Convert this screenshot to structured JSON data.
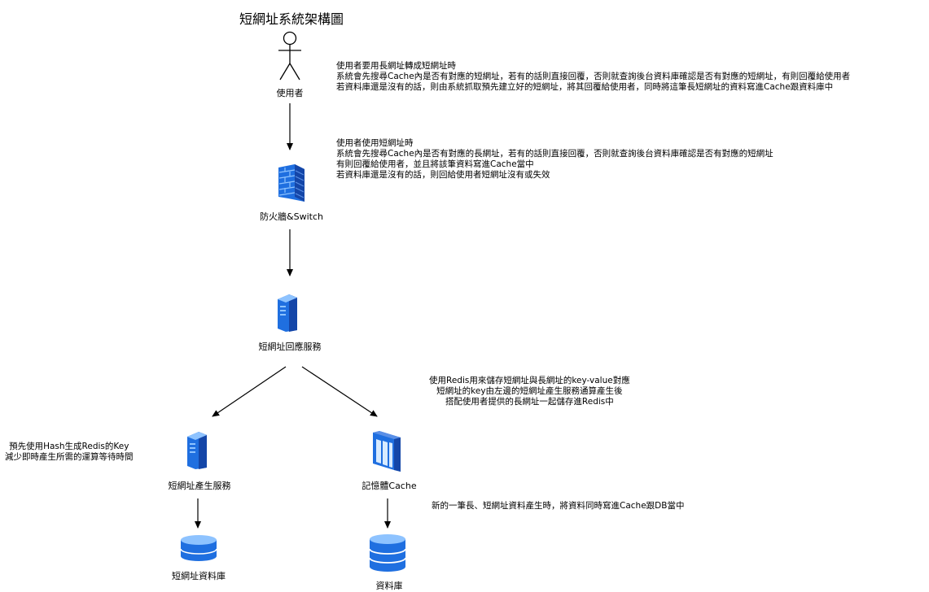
{
  "title": "短網址系統架構圖",
  "nodes": {
    "user": {
      "label": "使用者"
    },
    "firewall": {
      "label": "防火牆&Switch"
    },
    "reply_service": {
      "label": "短網址回應服務"
    },
    "gen_service": {
      "label": "短網址產生服務"
    },
    "cache": {
      "label": "記憶體Cache"
    },
    "short_db": {
      "label": "短網址資料庫"
    },
    "db": {
      "label": "資料庫"
    }
  },
  "notes": {
    "convert": "使用者要用長網址轉成短網址時\n系統會先搜尋Cache內是否有對應的短網址，若有的話則直接回覆，否則就查詢後台資料庫確認是否有對應的短網址，有則回覆給使用者\n若資料庫還是沒有的話，則由系統抓取預先建立好的短網址，將其回覆給使用者，同時將這筆長短網址的資料寫進Cache跟資料庫中",
    "use": "使用者使用短網址時\n系統會先搜尋Cache內是否有對應的長網址，若有的話則直接回覆，否則就查詢後台資料庫確認是否有對應的短網址\n有則回覆給使用者，並且將該筆資料寫進Cache當中\n若資料庫還是沒有的話，則回給使用者短網址沒有或失效",
    "redis": "使用Redis用來儲存短網址與長網址的key-value對應\n短網址的key由左邊的短網址產生服務通算產生後\n搭配使用者提供的長網址一起儲存進Redis中",
    "hash": "預先使用Hash生成Redis的Key\n減少即時產生所需的運算等待時間",
    "write": "新的一筆長、短網址資料產生時，將資料同時寫進Cache跟DB當中"
  },
  "colors": {
    "icon_blue": "#1f6fe0",
    "icon_dark": "#1446a8",
    "icon_light": "#8ec3ff"
  },
  "icons": {
    "user": "actor-icon",
    "firewall": "firewall-icon",
    "reply_service": "server-icon",
    "gen_service": "server-icon",
    "cache": "memory-cache-icon",
    "short_db": "database-icon",
    "db": "database-icon"
  }
}
